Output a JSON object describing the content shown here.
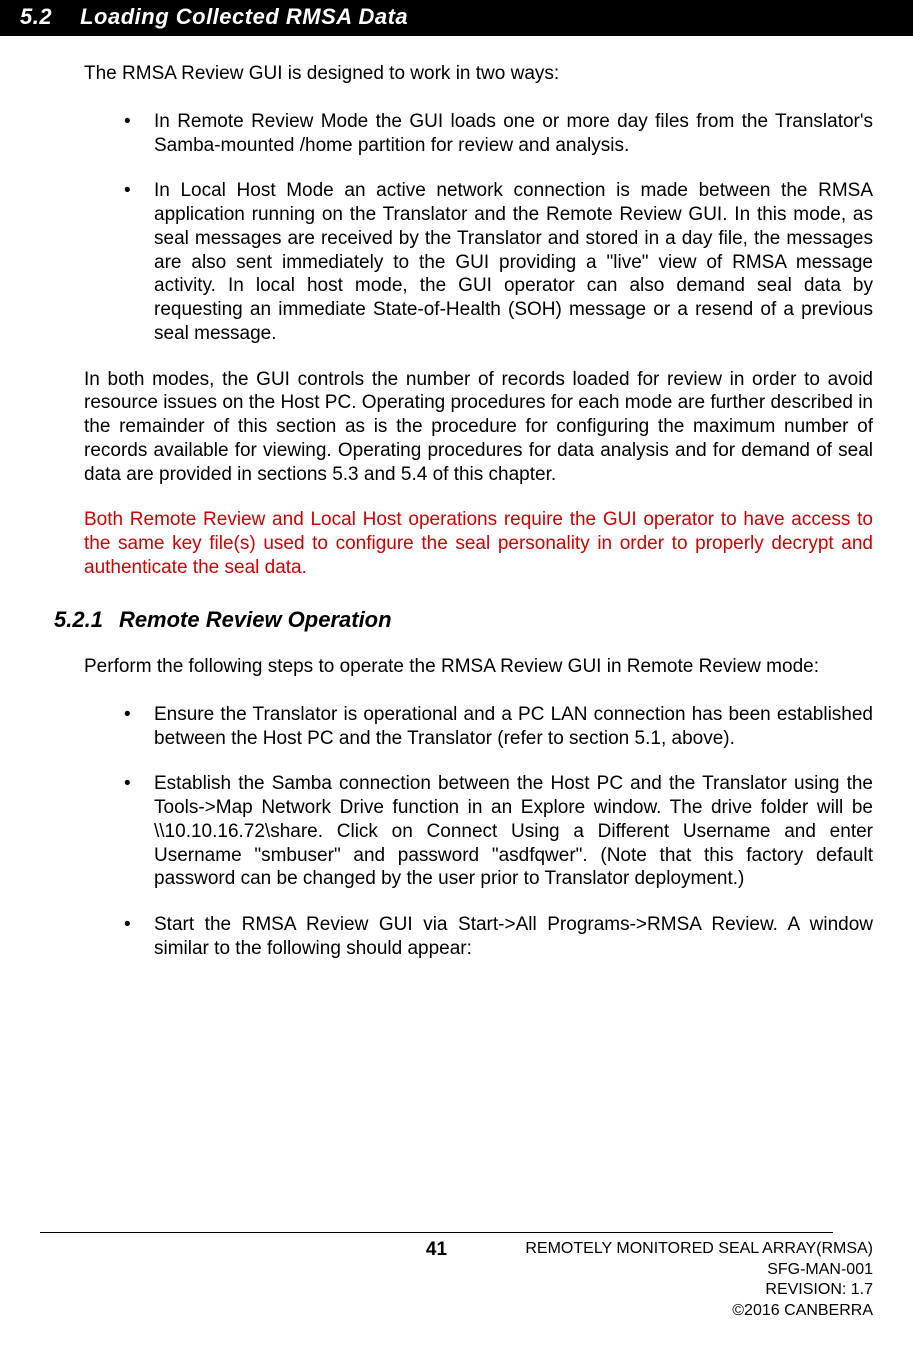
{
  "header": {
    "number": "5.2",
    "title": "Loading Collected RMSA Data"
  },
  "intro": "The RMSA Review GUI is designed to work in two ways:",
  "bullets1": [
    "In Remote Review Mode the GUI loads one or more day files from the Translator's Samba-mounted /home partition for review and analysis.",
    "In Local Host Mode an active network connection is made between the RMSA application running on the Translator and the Remote Review GUI.  In this mode, as seal messages are received by the Translator and stored in a day file, the messages are also sent immediately to the GUI providing a \"live\" view of RMSA message activity.  In local host mode, the GUI operator can also demand seal data by requesting an immediate State-of-Health (SOH) message or a resend of a previous seal message."
  ],
  "para1": "In both modes, the GUI controls the number of records loaded for review in order to avoid resource issues on the Host PC.  Operating procedures for each mode are further described in the remainder of this section as is the procedure for configuring the maximum number of records available for viewing.  Operating procedures for data analysis and for demand of seal data are provided in sections 5.3 and 5.4 of this chapter.",
  "redpara": "Both Remote Review and Local Host operations require the GUI operator to have access to the same key file(s) used to configure the seal personality in order to properly decrypt and authenticate the seal data.",
  "sub": {
    "number": "5.2.1",
    "title": "Remote Review Operation"
  },
  "intro2": "Perform the following steps to operate the RMSA Review GUI in Remote Review mode:",
  "bullets2": [
    "Ensure the Translator is operational and a PC LAN connection has been established between the Host PC and the Translator (refer to section 5.1, above).",
    "Establish the Samba connection between the Host PC and the Translator using the Tools->Map Network Drive function in an Explore window.  The drive folder will be \\\\10.10.16.72\\share.  Click on Connect Using a Different Username and enter Username \"smbuser\" and password \"asdfqwer\".  (Note that this factory default password can be changed by the user prior to Translator deployment.)",
    "Start the RMSA Review GUI via Start->All Programs->RMSA Review.  A window similar to the following should appear:"
  ],
  "footer": {
    "page": "41",
    "line1": "REMOTELY MONITORED SEAL ARRAY(RMSA)",
    "line2": "SFG-MAN-001",
    "line3": "REVISION: 1.7",
    "line4": "©2016 CANBERRA"
  }
}
